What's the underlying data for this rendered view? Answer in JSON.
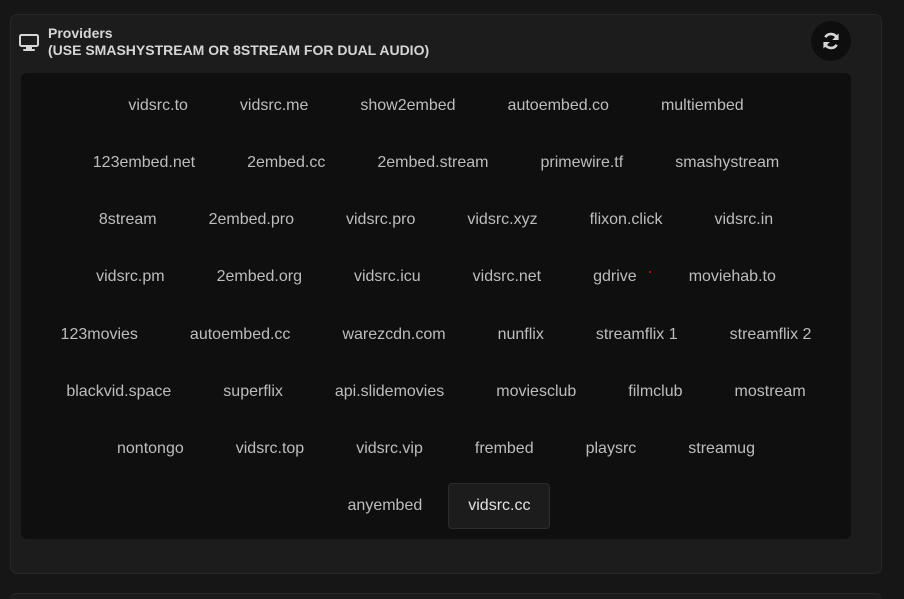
{
  "header": {
    "title": "Providers",
    "subtitle": "(USE SMASHYSTREAM OR 8STREAM FOR DUAL AUDIO)",
    "icon": "monitor-icon"
  },
  "refresh": {
    "icon": "refresh-icon"
  },
  "providers": {
    "rows": [
      [
        "vidsrc.to",
        "vidsrc.me",
        "show2embed",
        "autoembed.co",
        "multiembed"
      ],
      [
        "123embed.net",
        "2embed.cc",
        "2embed.stream",
        "primewire.tf",
        "smashystream"
      ],
      [
        "8stream",
        "2embed.pro",
        "vidsrc.pro",
        "vidsrc.xyz",
        "flixon.click",
        "vidsrc.in"
      ],
      [
        "vidsrc.pm",
        "2embed.org",
        "vidsrc.icu",
        "vidsrc.net",
        "gdrive",
        "moviehab.to"
      ],
      [
        "123movies",
        "autoembed.cc",
        "warezcdn.com",
        "nunflix",
        "streamflix 1",
        "streamflix 2"
      ],
      [
        "blackvid.space",
        "superflix",
        "api.slidemovies",
        "moviesclub",
        "filmclub",
        "mostream"
      ],
      [
        "nontongo",
        "vidsrc.top",
        "vidsrc.vip",
        "frembed",
        "playsrc",
        "streamug"
      ],
      [
        "anyembed",
        "vidsrc.cc"
      ]
    ],
    "selected": "vidsrc.cc"
  },
  "colors": {
    "background": "#161616",
    "panel": "#1c1c1c",
    "grid": "#0f0f0f",
    "text": "#bdbdbd",
    "selected_bg": "#1c1c1c"
  }
}
